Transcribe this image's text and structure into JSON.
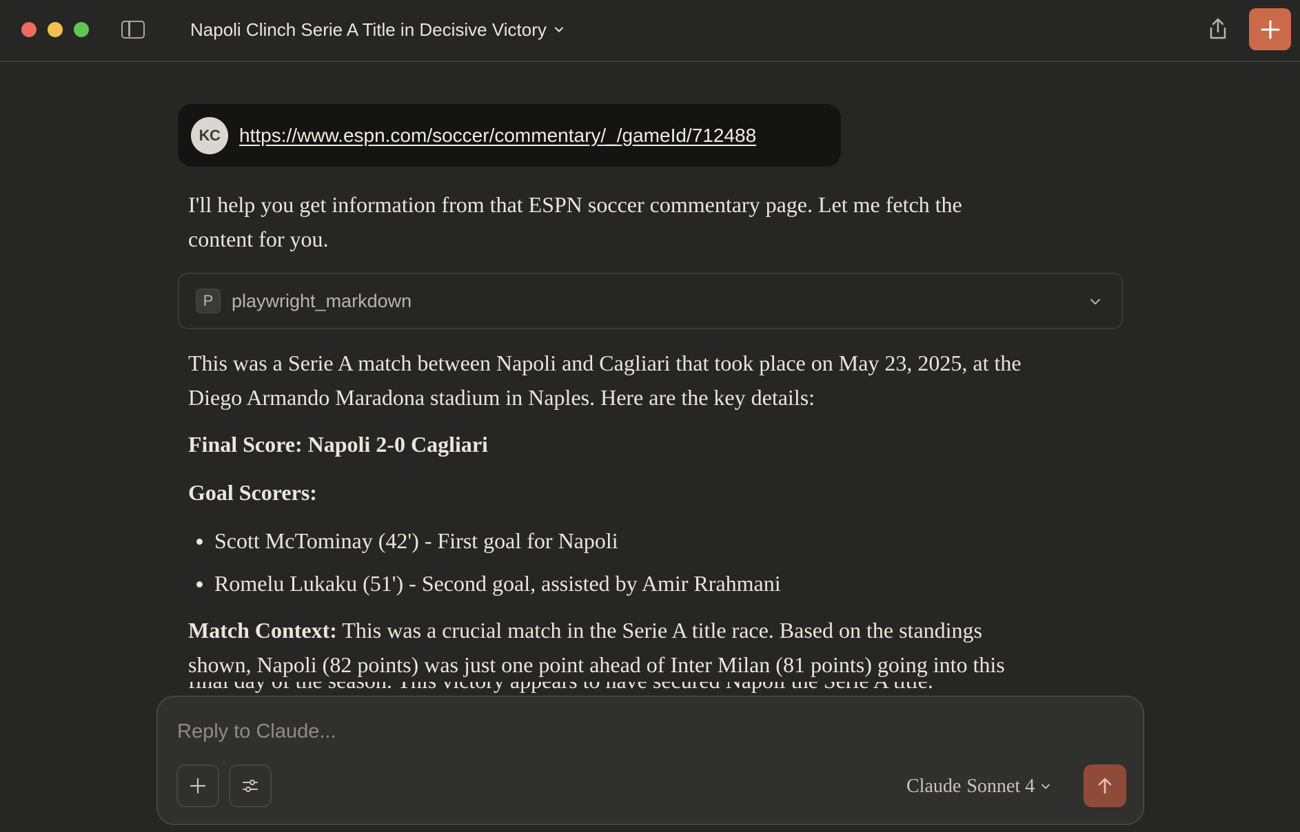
{
  "window": {
    "title": "Napoli Clinch Serie A Title in Decisive Victory"
  },
  "user_message": {
    "avatar_initials": "KC",
    "link": "https://www.espn.com/soccer/commentary/_/gameId/712488"
  },
  "assistant": {
    "intro_line1": "I'll help you get information from that ESPN soccer commentary page. Let me fetch the",
    "intro_line2": "content for you.",
    "tool_call": {
      "badge": "P",
      "name": "playwright_markdown"
    },
    "para1_line1": "This was a Serie A match between Napoli and Cagliari that took place on May 23, 2025, at the",
    "para1_line2": "Diego Armando Maradona stadium in Naples. Here are the key details:",
    "final_score": "Final Score: Napoli 2-0 Cagliari",
    "goal_scorers_heading": "Goal Scorers:",
    "goal_scorers": [
      "Scott McTominay (42') - First goal for Napoli",
      "Romelu Lukaku (51') - Second goal, assisted by Amir Rrahmani"
    ],
    "context_label": "Match Context:",
    "context_line1": " This was a crucial match in the Serie A title race. Based on the standings",
    "context_line2": "shown, Napoli (82 points) was just one point ahead of Inter Milan (81 points) going into this",
    "context_line3": "final day of the season. This victory appears to have secured Napoli the Serie A title."
  },
  "composer": {
    "placeholder": "Reply to Claude...",
    "model_name": "Claude",
    "model_version": "Sonnet 4"
  },
  "colors": {
    "background": "#262624",
    "accent": "#c96a4a",
    "send_button": "#8e4c38"
  },
  "icons": [
    "sidebar-toggle-icon",
    "chevron-down-icon",
    "share-icon",
    "plus-icon",
    "sliders-icon",
    "arrow-up-icon"
  ]
}
